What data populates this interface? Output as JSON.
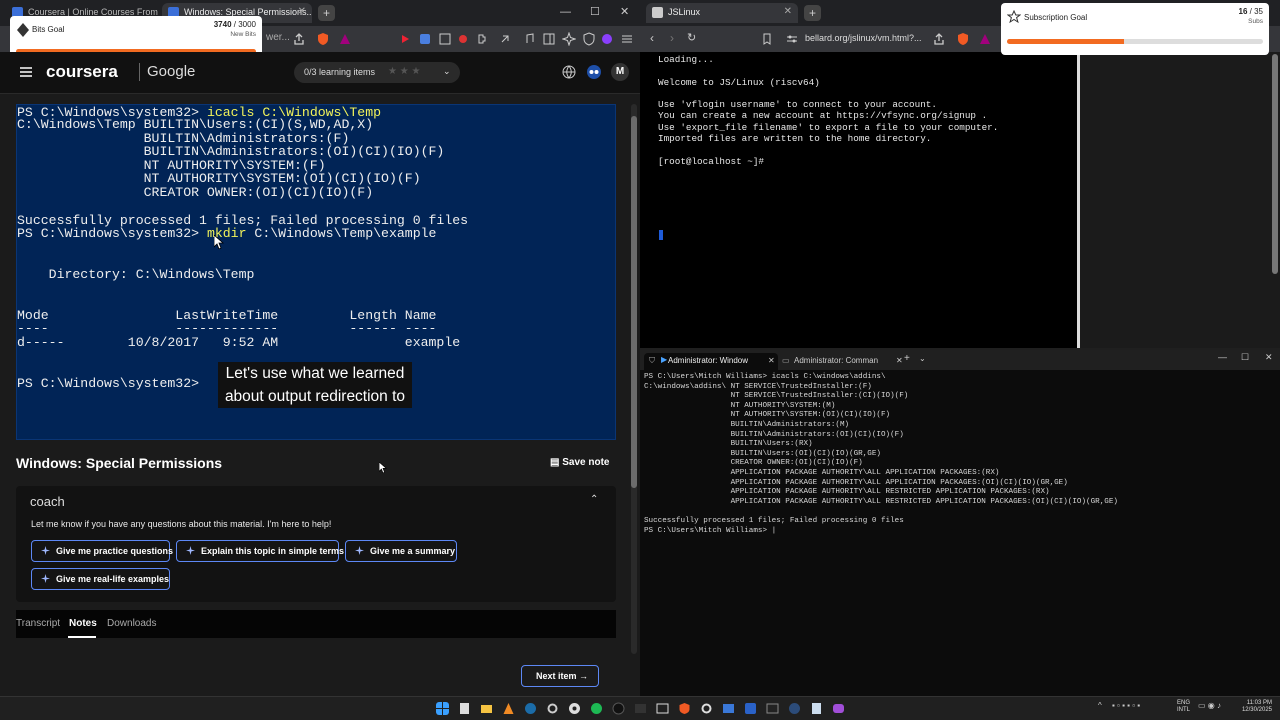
{
  "left_browser": {
    "tabs": [
      {
        "title": "Coursera | Online Courses From Top..."
      },
      {
        "title": "Windows: Special Permissions..."
      }
    ],
    "toolbar_partial_text": "wer..."
  },
  "bits_goal": {
    "label": "Bits Goal",
    "current": "3740",
    "total": "3000",
    "unit": "New Bits",
    "progress": 1.0
  },
  "subscription_goal": {
    "label": "Subscription Goal",
    "current": "16",
    "total": "35",
    "unit": "Subs",
    "progress": 0.457
  },
  "coursera": {
    "logo": "coursera",
    "partner": "Google",
    "learning_items": "0/3 learning items",
    "avatar_initial": "M",
    "lesson_title": "Windows: Special Permissions",
    "save_note": "Save note",
    "coach_title": "coach",
    "coach_message": "Let me know if you have any questions about this material. I'm here to help!",
    "coach_buttons": [
      "Give me practice questions",
      "Explain this topic in simple terms",
      "Give me a summary",
      "Give me real-life examples"
    ],
    "tabs": [
      "Transcript",
      "Notes",
      "Downloads"
    ],
    "active_tab": "Notes",
    "next_item": "Next item"
  },
  "ps_terminal": {
    "l1_prompt": "PS C:\\Windows\\system32> ",
    "l1_cmd": "icacls C:\\Windows\\Temp",
    "acl_lines": "C:\\Windows\\Temp BUILTIN\\Users:(CI)(S,WD,AD,X)\n                BUILTIN\\Administrators:(F)\n                BUILTIN\\Administrators:(OI)(CI)(IO)(F)\n                NT AUTHORITY\\SYSTEM:(F)\n                NT AUTHORITY\\SYSTEM:(OI)(CI)(IO)(F)\n                CREATOR OWNER:(OI)(CI)(IO)(F)",
    "success": "Successfully processed 1 files; Failed processing 0 files",
    "l2_prompt": "PS C:\\Windows\\system32> ",
    "l2_cmd": "mkdir",
    "l2_arg": " C:\\Windows\\Temp\\example",
    "directory_line": "    Directory: C:\\Windows\\Temp",
    "table_header": "Mode                LastWriteTime         Length Name",
    "table_rule": "----                -------------         ------ ----",
    "table_row": "d-----        10/8/2017   9:52 AM                example",
    "l3_prompt": "PS C:\\Windows\\system32>",
    "caption": "Let's use what we learned about output redirection to"
  },
  "jslinux": {
    "tab_title": "JSLinux",
    "url": "bellard.org/jslinux/vm.html?...",
    "output": "Loading...\n\nWelcome to JS/Linux (riscv64)\n\nUse 'vflogin username' to connect to your account.\nYou can create a new account at https://vfsync.org/signup .\nUse 'export_file filename' to export a file to your computer.\nImported files are written to the home directory.\n\n[root@localhost ~]#"
  },
  "win_terminal": {
    "tabs": [
      "Administrator: Window",
      "Administrator: Comman"
    ],
    "output": "PS C:\\Users\\Mitch Williams> icacls C:\\windows\\addins\\\nC:\\windows\\addins\\ NT SERVICE\\TrustedInstaller:(F)\n                   NT SERVICE\\TrustedInstaller:(CI)(IO)(F)\n                   NT AUTHORITY\\SYSTEM:(M)\n                   NT AUTHORITY\\SYSTEM:(OI)(CI)(IO)(F)\n                   BUILTIN\\Administrators:(M)\n                   BUILTIN\\Administrators:(OI)(CI)(IO)(F)\n                   BUILTIN\\Users:(RX)\n                   BUILTIN\\Users:(OI)(CI)(IO)(GR,GE)\n                   CREATOR OWNER:(OI)(CI)(IO)(F)\n                   APPLICATION PACKAGE AUTHORITY\\ALL APPLICATION PACKAGES:(RX)\n                   APPLICATION PACKAGE AUTHORITY\\ALL APPLICATION PACKAGES:(OI)(CI)(IO)(GR,GE)\n                   APPLICATION PACKAGE AUTHORITY\\ALL RESTRICTED APPLICATION PACKAGES:(RX)\n                   APPLICATION PACKAGE AUTHORITY\\ALL RESTRICTED APPLICATION PACKAGES:(OI)(CI)(IO)(GR,GE)\n\nSuccessfully processed 1 files; Failed processing 0 files\nPS C:\\Users\\Mitch Williams> |"
  },
  "taskbar": {
    "lang": "ENG",
    "layout": "INTL",
    "time": "11:03 PM",
    "date": "12/30/2025"
  },
  "colors": {
    "accent_blue": "#5d88f5",
    "ps_bg": "#012456",
    "goal_orange": "#f26b21"
  }
}
